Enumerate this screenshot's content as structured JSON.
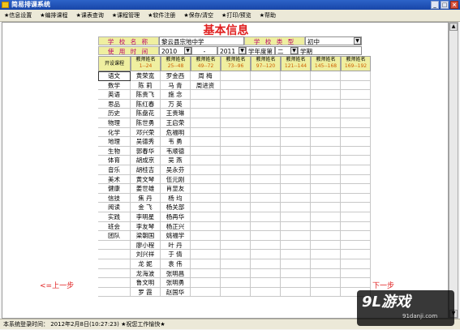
{
  "window": {
    "title": "简易排课系统"
  },
  "menu": [
    "★信息设置",
    "★编排课程",
    "★课表查询",
    "★课程管理",
    "★软件注册",
    "★保存/清空",
    "★打印/预览",
    "★帮助"
  ],
  "page_title": "基本信息",
  "form": {
    "school_name_label": "学 校 名 称",
    "school_name_value": "黎云县宗地中学",
    "school_type_label": "学 校 类 型",
    "school_type_value": "初中",
    "period_label": "使 用 时 间",
    "start_year": "2010",
    "dash": "-",
    "end_year": "2011",
    "year_text": "学年度第",
    "term_value": "二",
    "term_suffix": "学期"
  },
  "grid": {
    "first_header": "开设课程",
    "teacher_header": "教师姓名",
    "ranges": [
      "1--24",
      "25--48",
      "49--72",
      "73--96",
      "97--120",
      "121--144",
      "145--168",
      "169--192"
    ],
    "rows": [
      [
        "语文",
        "黄荣宽",
        "罗金西",
        "周 梅",
        "",
        "",
        "",
        "",
        ""
      ],
      [
        "数学",
        "陈 莉",
        "马 青",
        "周进资",
        "",
        "",
        "",
        "",
        ""
      ],
      [
        "英语",
        "陈贵飞",
        "施 念",
        "",
        "",
        "",
        "",
        "",
        ""
      ],
      [
        "思品",
        "陈红春",
        "万 英",
        "",
        "",
        "",
        "",
        "",
        ""
      ],
      [
        "历史",
        "陈盘花",
        "王贵琳",
        "",
        "",
        "",
        "",
        "",
        ""
      ],
      [
        "物理",
        "陈世勇",
        "王启荣",
        "",
        "",
        "",
        "",
        "",
        ""
      ],
      [
        "化学",
        "邓兴荣",
        "危福明",
        "",
        "",
        "",
        "",
        "",
        ""
      ],
      [
        "地理",
        "吴德秀",
        "韦 勇",
        "",
        "",
        "",
        "",
        "",
        ""
      ],
      [
        "生物",
        "郭春华",
        "韦顺德",
        "",
        "",
        "",
        "",
        "",
        ""
      ],
      [
        "体育",
        "胡成京",
        "吴 燕",
        "",
        "",
        "",
        "",
        "",
        ""
      ],
      [
        "音乐",
        "胡桂吉",
        "吴永芬",
        "",
        "",
        "",
        "",
        "",
        ""
      ],
      [
        "美术",
        "黄文琴",
        "伍元刚",
        "",
        "",
        "",
        "",
        "",
        ""
      ],
      [
        "健康",
        "姜世雄",
        "肖显友",
        "",
        "",
        "",
        "",
        "",
        ""
      ],
      [
        "信技",
        "焦 丹",
        "杨 均",
        "",
        "",
        "",
        "",
        "",
        ""
      ],
      [
        "阅读",
        "金 飞",
        "杨关部",
        "",
        "",
        "",
        "",
        "",
        ""
      ],
      [
        "实践",
        "李明星",
        "杨再华",
        "",
        "",
        "",
        "",
        "",
        ""
      ],
      [
        "班会",
        "李友琴",
        "杨正兴",
        "",
        "",
        "",
        "",
        "",
        ""
      ],
      [
        "团队",
        "梁朝国",
        "姚福学",
        "",
        "",
        "",
        "",
        "",
        ""
      ],
      [
        "",
        "廖小程",
        "叶 丹",
        "",
        "",
        "",
        "",
        "",
        ""
      ],
      [
        "",
        "刘兴祥",
        "于 倩",
        "",
        "",
        "",
        "",
        "",
        ""
      ],
      [
        "",
        "龙 妮",
        "袁 伟",
        "",
        "",
        "",
        "",
        "",
        ""
      ],
      [
        "",
        "龙海波",
        "张明昌",
        "",
        "",
        "",
        "",
        "",
        ""
      ],
      [
        "",
        "鲁文明",
        "张明勇",
        "",
        "",
        "",
        "",
        "",
        ""
      ],
      [
        "",
        "罗 霞",
        "赵国华",
        "",
        "",
        "",
        "",
        "",
        ""
      ]
    ]
  },
  "nav": {
    "prev": "<=上一步",
    "next": "下一步"
  },
  "status": "本系统登录时间： 2012年2月8日(10:27:23)   ★祝您工作愉快★",
  "logo": {
    "main": "9L游戏",
    "sub": "91danji.com"
  }
}
